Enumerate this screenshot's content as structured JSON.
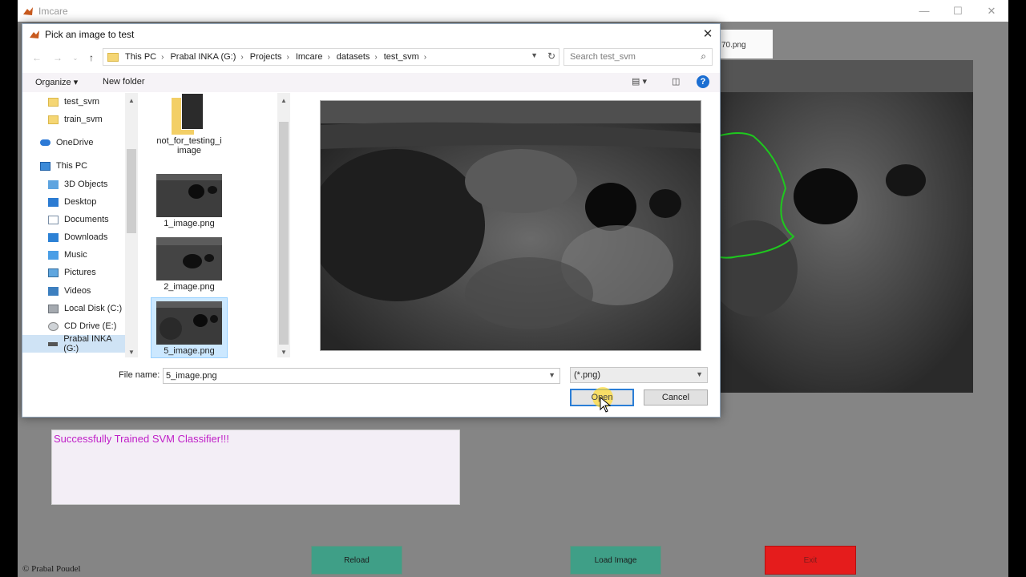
{
  "main_window": {
    "title": "Imcare",
    "controls": {
      "minimize": "—",
      "maximize": "☐",
      "close": "✕"
    },
    "bg_filename": "70.png",
    "status_text": "Successfully Trained SVM Classifier!!!",
    "buttons": {
      "reload": "Reload",
      "load_image": "Load Image",
      "exit": "Exit"
    },
    "copyright": "© Prabal Poudel"
  },
  "dialog": {
    "title": "Pick an image to test",
    "close": "✕",
    "breadcrumbs": [
      "This PC",
      "Prabal INKA (G:)",
      "Projects",
      "Imcare",
      "datasets",
      "test_svm"
    ],
    "search_placeholder": "Search test_svm",
    "toolbar": {
      "organize": "Organize ▾",
      "new_folder": "New folder"
    },
    "nav_items": [
      {
        "label": "test_svm",
        "icon": "folder"
      },
      {
        "label": "train_svm",
        "icon": "folder"
      },
      {
        "label": "OneDrive",
        "icon": "cloud"
      },
      {
        "label": "This PC",
        "icon": "pc"
      },
      {
        "label": "3D Objects",
        "icon": "cube"
      },
      {
        "label": "Desktop",
        "icon": "desk"
      },
      {
        "label": "Documents",
        "icon": "doc"
      },
      {
        "label": "Downloads",
        "icon": "down"
      },
      {
        "label": "Music",
        "icon": "music"
      },
      {
        "label": "Pictures",
        "icon": "pic"
      },
      {
        "label": "Videos",
        "icon": "vid"
      },
      {
        "label": "Local Disk (C:)",
        "icon": "disk"
      },
      {
        "label": "CD Drive (E:)",
        "icon": "cd"
      },
      {
        "label": "Prabal INKA (G:)",
        "icon": "usb"
      }
    ],
    "files": [
      {
        "name_line1": "not_for_testing_i",
        "name_line2": "image"
      },
      {
        "name": "1_image.png"
      },
      {
        "name": "2_image.png"
      },
      {
        "name": "5_image.png"
      }
    ],
    "file_name_label": "File name:",
    "file_name_value": "5_image.png",
    "filter": "(*.png)",
    "open_label": "Open",
    "cancel_label": "Cancel"
  }
}
